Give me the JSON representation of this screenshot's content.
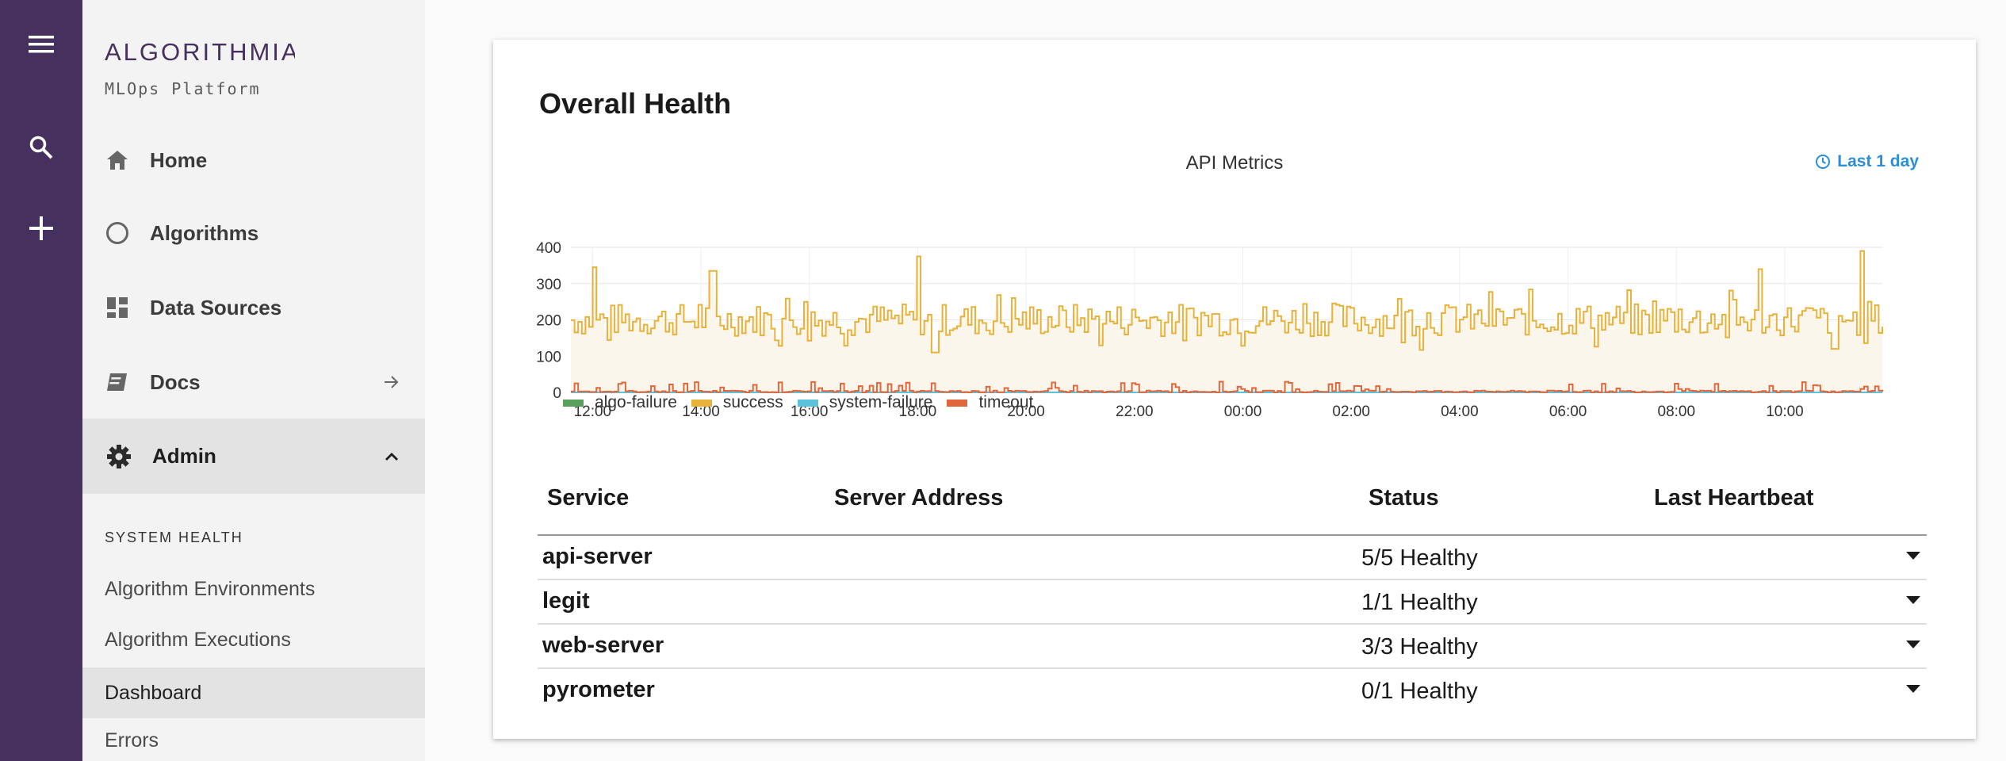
{
  "colors": {
    "rail": "#46305e",
    "brand": "#46305e",
    "accent": "#2a8fd8"
  },
  "rail": {
    "icons": [
      "menu-icon",
      "search-icon",
      "plus-icon"
    ]
  },
  "brand": {
    "name": "ALGORITHMIA",
    "tagline": "MLOps Platform"
  },
  "nav": {
    "home": "Home",
    "algorithms": "Algorithms",
    "data_sources": "Data Sources",
    "docs": "Docs",
    "admin": "Admin"
  },
  "admin_menu": {
    "section": "SYSTEM HEALTH",
    "items": [
      "Algorithm Environments",
      "Algorithm Executions",
      "Dashboard",
      "Errors"
    ],
    "active": "Dashboard"
  },
  "card": {
    "title": "Overall Health",
    "range_label": "Last 1 day"
  },
  "chart_data": {
    "type": "line",
    "title": "API Metrics",
    "x_tick_labels": [
      "12:00",
      "14:00",
      "16:00",
      "18:00",
      "20:00",
      "22:00",
      "00:00",
      "02:00",
      "04:00",
      "06:00",
      "08:00",
      "10:00"
    ],
    "x_range_hours": [
      11.6,
      35.8
    ],
    "ylim": [
      0,
      400
    ],
    "y_ticks": [
      "0",
      "100",
      "200",
      "300",
      "400"
    ],
    "grid": true,
    "legend_position": "bottom-left",
    "series": [
      {
        "name": "algo-failure",
        "color": "#5aa05a",
        "level": 0,
        "values": []
      },
      {
        "name": "success",
        "color": "#e8b23a",
        "fill": "#faf6ec",
        "values": []
      },
      {
        "name": "system-failure",
        "color": "#5bc2dc",
        "level": 0,
        "values": []
      },
      {
        "name": "timeout",
        "color": "#e2663c",
        "values": []
      }
    ],
    "success_profile": {
      "baseline": 200,
      "fluctuation": 90,
      "peaks": [
        [
          12.0,
          345
        ],
        [
          14.2,
          335
        ],
        [
          18.0,
          375
        ],
        [
          33.5,
          340
        ],
        [
          35.4,
          390
        ]
      ],
      "dips": [
        [
          18.3,
          105
        ],
        [
          34.9,
          120
        ]
      ]
    },
    "timeout_profile": {
      "baseline": 5,
      "max_spike": 30
    }
  },
  "table": {
    "headers": [
      "Service",
      "Server Address",
      "Status",
      "Last Heartbeat"
    ],
    "rows": [
      {
        "service": "api-server",
        "address": "",
        "status": "5/5 Healthy",
        "heartbeat": ""
      },
      {
        "service": "legit",
        "address": "",
        "status": "1/1 Healthy",
        "heartbeat": ""
      },
      {
        "service": "web-server",
        "address": "",
        "status": "3/3 Healthy",
        "heartbeat": ""
      },
      {
        "service": "pyrometer",
        "address": "",
        "status": "0/1 Healthy",
        "heartbeat": ""
      }
    ]
  }
}
